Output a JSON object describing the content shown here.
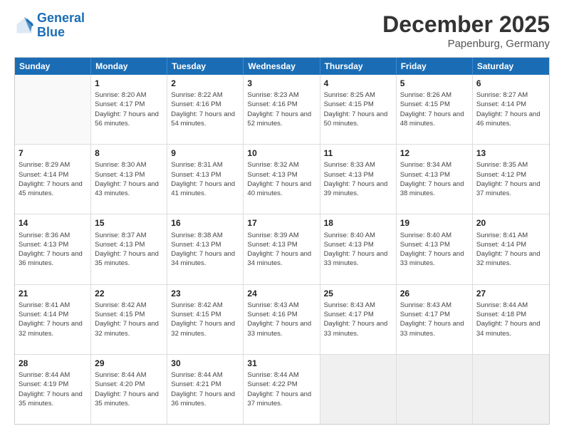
{
  "logo": {
    "line1": "General",
    "line2": "Blue"
  },
  "title": "December 2025",
  "location": "Papenburg, Germany",
  "header_days": [
    "Sunday",
    "Monday",
    "Tuesday",
    "Wednesday",
    "Thursday",
    "Friday",
    "Saturday"
  ],
  "weeks": [
    [
      {
        "day": "",
        "sunrise": "",
        "sunset": "",
        "daylight": ""
      },
      {
        "day": "1",
        "sunrise": "Sunrise: 8:20 AM",
        "sunset": "Sunset: 4:17 PM",
        "daylight": "Daylight: 7 hours and 56 minutes."
      },
      {
        "day": "2",
        "sunrise": "Sunrise: 8:22 AM",
        "sunset": "Sunset: 4:16 PM",
        "daylight": "Daylight: 7 hours and 54 minutes."
      },
      {
        "day": "3",
        "sunrise": "Sunrise: 8:23 AM",
        "sunset": "Sunset: 4:16 PM",
        "daylight": "Daylight: 7 hours and 52 minutes."
      },
      {
        "day": "4",
        "sunrise": "Sunrise: 8:25 AM",
        "sunset": "Sunset: 4:15 PM",
        "daylight": "Daylight: 7 hours and 50 minutes."
      },
      {
        "day": "5",
        "sunrise": "Sunrise: 8:26 AM",
        "sunset": "Sunset: 4:15 PM",
        "daylight": "Daylight: 7 hours and 48 minutes."
      },
      {
        "day": "6",
        "sunrise": "Sunrise: 8:27 AM",
        "sunset": "Sunset: 4:14 PM",
        "daylight": "Daylight: 7 hours and 46 minutes."
      }
    ],
    [
      {
        "day": "7",
        "sunrise": "Sunrise: 8:29 AM",
        "sunset": "Sunset: 4:14 PM",
        "daylight": "Daylight: 7 hours and 45 minutes."
      },
      {
        "day": "8",
        "sunrise": "Sunrise: 8:30 AM",
        "sunset": "Sunset: 4:13 PM",
        "daylight": "Daylight: 7 hours and 43 minutes."
      },
      {
        "day": "9",
        "sunrise": "Sunrise: 8:31 AM",
        "sunset": "Sunset: 4:13 PM",
        "daylight": "Daylight: 7 hours and 41 minutes."
      },
      {
        "day": "10",
        "sunrise": "Sunrise: 8:32 AM",
        "sunset": "Sunset: 4:13 PM",
        "daylight": "Daylight: 7 hours and 40 minutes."
      },
      {
        "day": "11",
        "sunrise": "Sunrise: 8:33 AM",
        "sunset": "Sunset: 4:13 PM",
        "daylight": "Daylight: 7 hours and 39 minutes."
      },
      {
        "day": "12",
        "sunrise": "Sunrise: 8:34 AM",
        "sunset": "Sunset: 4:13 PM",
        "daylight": "Daylight: 7 hours and 38 minutes."
      },
      {
        "day": "13",
        "sunrise": "Sunrise: 8:35 AM",
        "sunset": "Sunset: 4:12 PM",
        "daylight": "Daylight: 7 hours and 37 minutes."
      }
    ],
    [
      {
        "day": "14",
        "sunrise": "Sunrise: 8:36 AM",
        "sunset": "Sunset: 4:13 PM",
        "daylight": "Daylight: 7 hours and 36 minutes."
      },
      {
        "day": "15",
        "sunrise": "Sunrise: 8:37 AM",
        "sunset": "Sunset: 4:13 PM",
        "daylight": "Daylight: 7 hours and 35 minutes."
      },
      {
        "day": "16",
        "sunrise": "Sunrise: 8:38 AM",
        "sunset": "Sunset: 4:13 PM",
        "daylight": "Daylight: 7 hours and 34 minutes."
      },
      {
        "day": "17",
        "sunrise": "Sunrise: 8:39 AM",
        "sunset": "Sunset: 4:13 PM",
        "daylight": "Daylight: 7 hours and 34 minutes."
      },
      {
        "day": "18",
        "sunrise": "Sunrise: 8:40 AM",
        "sunset": "Sunset: 4:13 PM",
        "daylight": "Daylight: 7 hours and 33 minutes."
      },
      {
        "day": "19",
        "sunrise": "Sunrise: 8:40 AM",
        "sunset": "Sunset: 4:13 PM",
        "daylight": "Daylight: 7 hours and 33 minutes."
      },
      {
        "day": "20",
        "sunrise": "Sunrise: 8:41 AM",
        "sunset": "Sunset: 4:14 PM",
        "daylight": "Daylight: 7 hours and 32 minutes."
      }
    ],
    [
      {
        "day": "21",
        "sunrise": "Sunrise: 8:41 AM",
        "sunset": "Sunset: 4:14 PM",
        "daylight": "Daylight: 7 hours and 32 minutes."
      },
      {
        "day": "22",
        "sunrise": "Sunrise: 8:42 AM",
        "sunset": "Sunset: 4:15 PM",
        "daylight": "Daylight: 7 hours and 32 minutes."
      },
      {
        "day": "23",
        "sunrise": "Sunrise: 8:42 AM",
        "sunset": "Sunset: 4:15 PM",
        "daylight": "Daylight: 7 hours and 32 minutes."
      },
      {
        "day": "24",
        "sunrise": "Sunrise: 8:43 AM",
        "sunset": "Sunset: 4:16 PM",
        "daylight": "Daylight: 7 hours and 33 minutes."
      },
      {
        "day": "25",
        "sunrise": "Sunrise: 8:43 AM",
        "sunset": "Sunset: 4:17 PM",
        "daylight": "Daylight: 7 hours and 33 minutes."
      },
      {
        "day": "26",
        "sunrise": "Sunrise: 8:43 AM",
        "sunset": "Sunset: 4:17 PM",
        "daylight": "Daylight: 7 hours and 33 minutes."
      },
      {
        "day": "27",
        "sunrise": "Sunrise: 8:44 AM",
        "sunset": "Sunset: 4:18 PM",
        "daylight": "Daylight: 7 hours and 34 minutes."
      }
    ],
    [
      {
        "day": "28",
        "sunrise": "Sunrise: 8:44 AM",
        "sunset": "Sunset: 4:19 PM",
        "daylight": "Daylight: 7 hours and 35 minutes."
      },
      {
        "day": "29",
        "sunrise": "Sunrise: 8:44 AM",
        "sunset": "Sunset: 4:20 PM",
        "daylight": "Daylight: 7 hours and 35 minutes."
      },
      {
        "day": "30",
        "sunrise": "Sunrise: 8:44 AM",
        "sunset": "Sunset: 4:21 PM",
        "daylight": "Daylight: 7 hours and 36 minutes."
      },
      {
        "day": "31",
        "sunrise": "Sunrise: 8:44 AM",
        "sunset": "Sunset: 4:22 PM",
        "daylight": "Daylight: 7 hours and 37 minutes."
      },
      {
        "day": "",
        "sunrise": "",
        "sunset": "",
        "daylight": ""
      },
      {
        "day": "",
        "sunrise": "",
        "sunset": "",
        "daylight": ""
      },
      {
        "day": "",
        "sunrise": "",
        "sunset": "",
        "daylight": ""
      }
    ]
  ]
}
